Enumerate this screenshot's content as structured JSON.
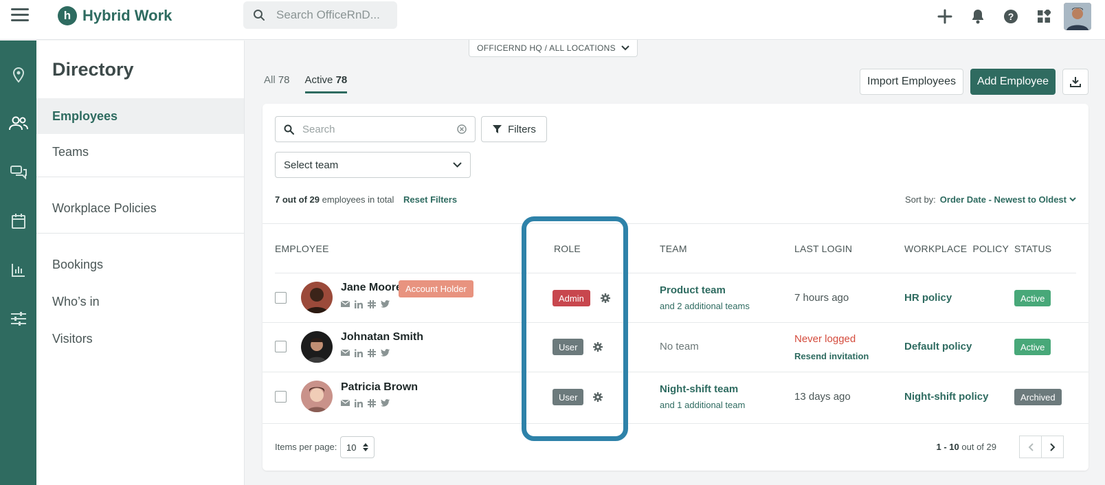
{
  "app": {
    "title": "Hybrid Work"
  },
  "search": {
    "placeholder": "Search OfficeRnD..."
  },
  "location": {
    "label": "OFFICERND HQ / ALL LOCATIONS"
  },
  "sidebar": {
    "title": "Directory",
    "items": [
      {
        "label": "Employees"
      },
      {
        "label": "Teams"
      },
      {
        "label": "Workplace Policies"
      },
      {
        "label": "Bookings"
      },
      {
        "label": "Who’s in"
      },
      {
        "label": "Visitors"
      }
    ]
  },
  "tabs": {
    "all": {
      "label": "All",
      "count": "78"
    },
    "active": {
      "label": "Active",
      "count": "78"
    }
  },
  "actions": {
    "import": "Import Employees",
    "add": "Add Employee"
  },
  "filters": {
    "search_placeholder": "Search",
    "filters_label": "Filters",
    "team_select": "Select team",
    "count_bold": "7 out of 29",
    "count_rest": "employees in total",
    "reset": "Reset Filters",
    "sort_label": "Sort by:",
    "sort_value": "Order Date - Newest to Oldest"
  },
  "table": {
    "headers": {
      "employee": "EMPLOYEE",
      "role": "ROLE",
      "team": "TEAM",
      "last_login": "LAST LOGIN",
      "policy": "WORKPLACE  POLICY",
      "status": "STATUS"
    },
    "rows": [
      {
        "name": "Jane Moore",
        "badge": "Account Holder",
        "role": "Admin",
        "team": "Product team",
        "team_extra": "and 2 additional teams",
        "last_login": "7 hours ago",
        "policy": "HR policy",
        "status": "Active"
      },
      {
        "name": "Johnatan Smith",
        "role": "User",
        "team": "No team",
        "last_login": "Never logged",
        "resend": "Resend invitation",
        "policy": "Default policy",
        "status": "Active"
      },
      {
        "name": "Patricia Brown",
        "role": "User",
        "team": "Night-shift team",
        "team_extra": "and 1 additional team",
        "last_login": "13 days ago",
        "policy": "Night-shift policy",
        "status": "Archived"
      }
    ]
  },
  "pagination": {
    "items_per_page_label": "Items per page:",
    "items_per_page": "10",
    "range": "1 - 10",
    "total": "out of 29"
  },
  "colors": {
    "brand": "#2f6b60",
    "admin": "#c8474e",
    "user": "#6c7a7c",
    "active": "#48a879",
    "archived": "#6c7a7c",
    "account_holder": "#e8937f",
    "highlight": "#2e82a9"
  },
  "icons": {
    "rail": [
      "location-icon",
      "people-icon",
      "chat-icon",
      "calendar-icon",
      "analytics-icon",
      "settings-sliders-icon"
    ],
    "top": [
      "plus-icon",
      "bell-icon",
      "help-icon",
      "apps-icon"
    ]
  }
}
